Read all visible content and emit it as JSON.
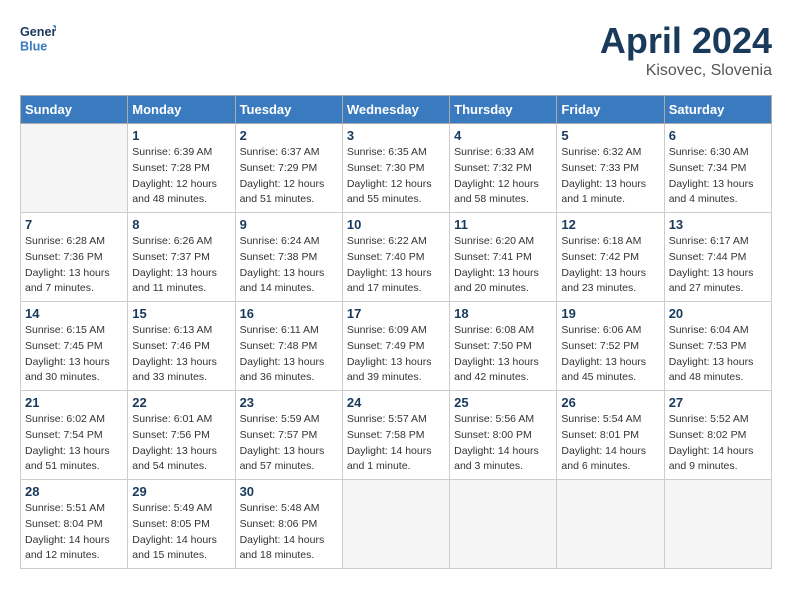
{
  "header": {
    "logo_line1": "General",
    "logo_line2": "Blue",
    "month": "April 2024",
    "location": "Kisovec, Slovenia"
  },
  "weekdays": [
    "Sunday",
    "Monday",
    "Tuesday",
    "Wednesday",
    "Thursday",
    "Friday",
    "Saturday"
  ],
  "weeks": [
    [
      {
        "day": "",
        "empty": true
      },
      {
        "day": "1",
        "sunrise": "Sunrise: 6:39 AM",
        "sunset": "Sunset: 7:28 PM",
        "daylight": "Daylight: 12 hours and 48 minutes."
      },
      {
        "day": "2",
        "sunrise": "Sunrise: 6:37 AM",
        "sunset": "Sunset: 7:29 PM",
        "daylight": "Daylight: 12 hours and 51 minutes."
      },
      {
        "day": "3",
        "sunrise": "Sunrise: 6:35 AM",
        "sunset": "Sunset: 7:30 PM",
        "daylight": "Daylight: 12 hours and 55 minutes."
      },
      {
        "day": "4",
        "sunrise": "Sunrise: 6:33 AM",
        "sunset": "Sunset: 7:32 PM",
        "daylight": "Daylight: 12 hours and 58 minutes."
      },
      {
        "day": "5",
        "sunrise": "Sunrise: 6:32 AM",
        "sunset": "Sunset: 7:33 PM",
        "daylight": "Daylight: 13 hours and 1 minute."
      },
      {
        "day": "6",
        "sunrise": "Sunrise: 6:30 AM",
        "sunset": "Sunset: 7:34 PM",
        "daylight": "Daylight: 13 hours and 4 minutes."
      }
    ],
    [
      {
        "day": "7",
        "sunrise": "Sunrise: 6:28 AM",
        "sunset": "Sunset: 7:36 PM",
        "daylight": "Daylight: 13 hours and 7 minutes."
      },
      {
        "day": "8",
        "sunrise": "Sunrise: 6:26 AM",
        "sunset": "Sunset: 7:37 PM",
        "daylight": "Daylight: 13 hours and 11 minutes."
      },
      {
        "day": "9",
        "sunrise": "Sunrise: 6:24 AM",
        "sunset": "Sunset: 7:38 PM",
        "daylight": "Daylight: 13 hours and 14 minutes."
      },
      {
        "day": "10",
        "sunrise": "Sunrise: 6:22 AM",
        "sunset": "Sunset: 7:40 PM",
        "daylight": "Daylight: 13 hours and 17 minutes."
      },
      {
        "day": "11",
        "sunrise": "Sunrise: 6:20 AM",
        "sunset": "Sunset: 7:41 PM",
        "daylight": "Daylight: 13 hours and 20 minutes."
      },
      {
        "day": "12",
        "sunrise": "Sunrise: 6:18 AM",
        "sunset": "Sunset: 7:42 PM",
        "daylight": "Daylight: 13 hours and 23 minutes."
      },
      {
        "day": "13",
        "sunrise": "Sunrise: 6:17 AM",
        "sunset": "Sunset: 7:44 PM",
        "daylight": "Daylight: 13 hours and 27 minutes."
      }
    ],
    [
      {
        "day": "14",
        "sunrise": "Sunrise: 6:15 AM",
        "sunset": "Sunset: 7:45 PM",
        "daylight": "Daylight: 13 hours and 30 minutes."
      },
      {
        "day": "15",
        "sunrise": "Sunrise: 6:13 AM",
        "sunset": "Sunset: 7:46 PM",
        "daylight": "Daylight: 13 hours and 33 minutes."
      },
      {
        "day": "16",
        "sunrise": "Sunrise: 6:11 AM",
        "sunset": "Sunset: 7:48 PM",
        "daylight": "Daylight: 13 hours and 36 minutes."
      },
      {
        "day": "17",
        "sunrise": "Sunrise: 6:09 AM",
        "sunset": "Sunset: 7:49 PM",
        "daylight": "Daylight: 13 hours and 39 minutes."
      },
      {
        "day": "18",
        "sunrise": "Sunrise: 6:08 AM",
        "sunset": "Sunset: 7:50 PM",
        "daylight": "Daylight: 13 hours and 42 minutes."
      },
      {
        "day": "19",
        "sunrise": "Sunrise: 6:06 AM",
        "sunset": "Sunset: 7:52 PM",
        "daylight": "Daylight: 13 hours and 45 minutes."
      },
      {
        "day": "20",
        "sunrise": "Sunrise: 6:04 AM",
        "sunset": "Sunset: 7:53 PM",
        "daylight": "Daylight: 13 hours and 48 minutes."
      }
    ],
    [
      {
        "day": "21",
        "sunrise": "Sunrise: 6:02 AM",
        "sunset": "Sunset: 7:54 PM",
        "daylight": "Daylight: 13 hours and 51 minutes."
      },
      {
        "day": "22",
        "sunrise": "Sunrise: 6:01 AM",
        "sunset": "Sunset: 7:56 PM",
        "daylight": "Daylight: 13 hours and 54 minutes."
      },
      {
        "day": "23",
        "sunrise": "Sunrise: 5:59 AM",
        "sunset": "Sunset: 7:57 PM",
        "daylight": "Daylight: 13 hours and 57 minutes."
      },
      {
        "day": "24",
        "sunrise": "Sunrise: 5:57 AM",
        "sunset": "Sunset: 7:58 PM",
        "daylight": "Daylight: 14 hours and 1 minute."
      },
      {
        "day": "25",
        "sunrise": "Sunrise: 5:56 AM",
        "sunset": "Sunset: 8:00 PM",
        "daylight": "Daylight: 14 hours and 3 minutes."
      },
      {
        "day": "26",
        "sunrise": "Sunrise: 5:54 AM",
        "sunset": "Sunset: 8:01 PM",
        "daylight": "Daylight: 14 hours and 6 minutes."
      },
      {
        "day": "27",
        "sunrise": "Sunrise: 5:52 AM",
        "sunset": "Sunset: 8:02 PM",
        "daylight": "Daylight: 14 hours and 9 minutes."
      }
    ],
    [
      {
        "day": "28",
        "sunrise": "Sunrise: 5:51 AM",
        "sunset": "Sunset: 8:04 PM",
        "daylight": "Daylight: 14 hours and 12 minutes."
      },
      {
        "day": "29",
        "sunrise": "Sunrise: 5:49 AM",
        "sunset": "Sunset: 8:05 PM",
        "daylight": "Daylight: 14 hours and 15 minutes."
      },
      {
        "day": "30",
        "sunrise": "Sunrise: 5:48 AM",
        "sunset": "Sunset: 8:06 PM",
        "daylight": "Daylight: 14 hours and 18 minutes."
      },
      {
        "day": "",
        "empty": true
      },
      {
        "day": "",
        "empty": true
      },
      {
        "day": "",
        "empty": true
      },
      {
        "day": "",
        "empty": true
      }
    ]
  ]
}
